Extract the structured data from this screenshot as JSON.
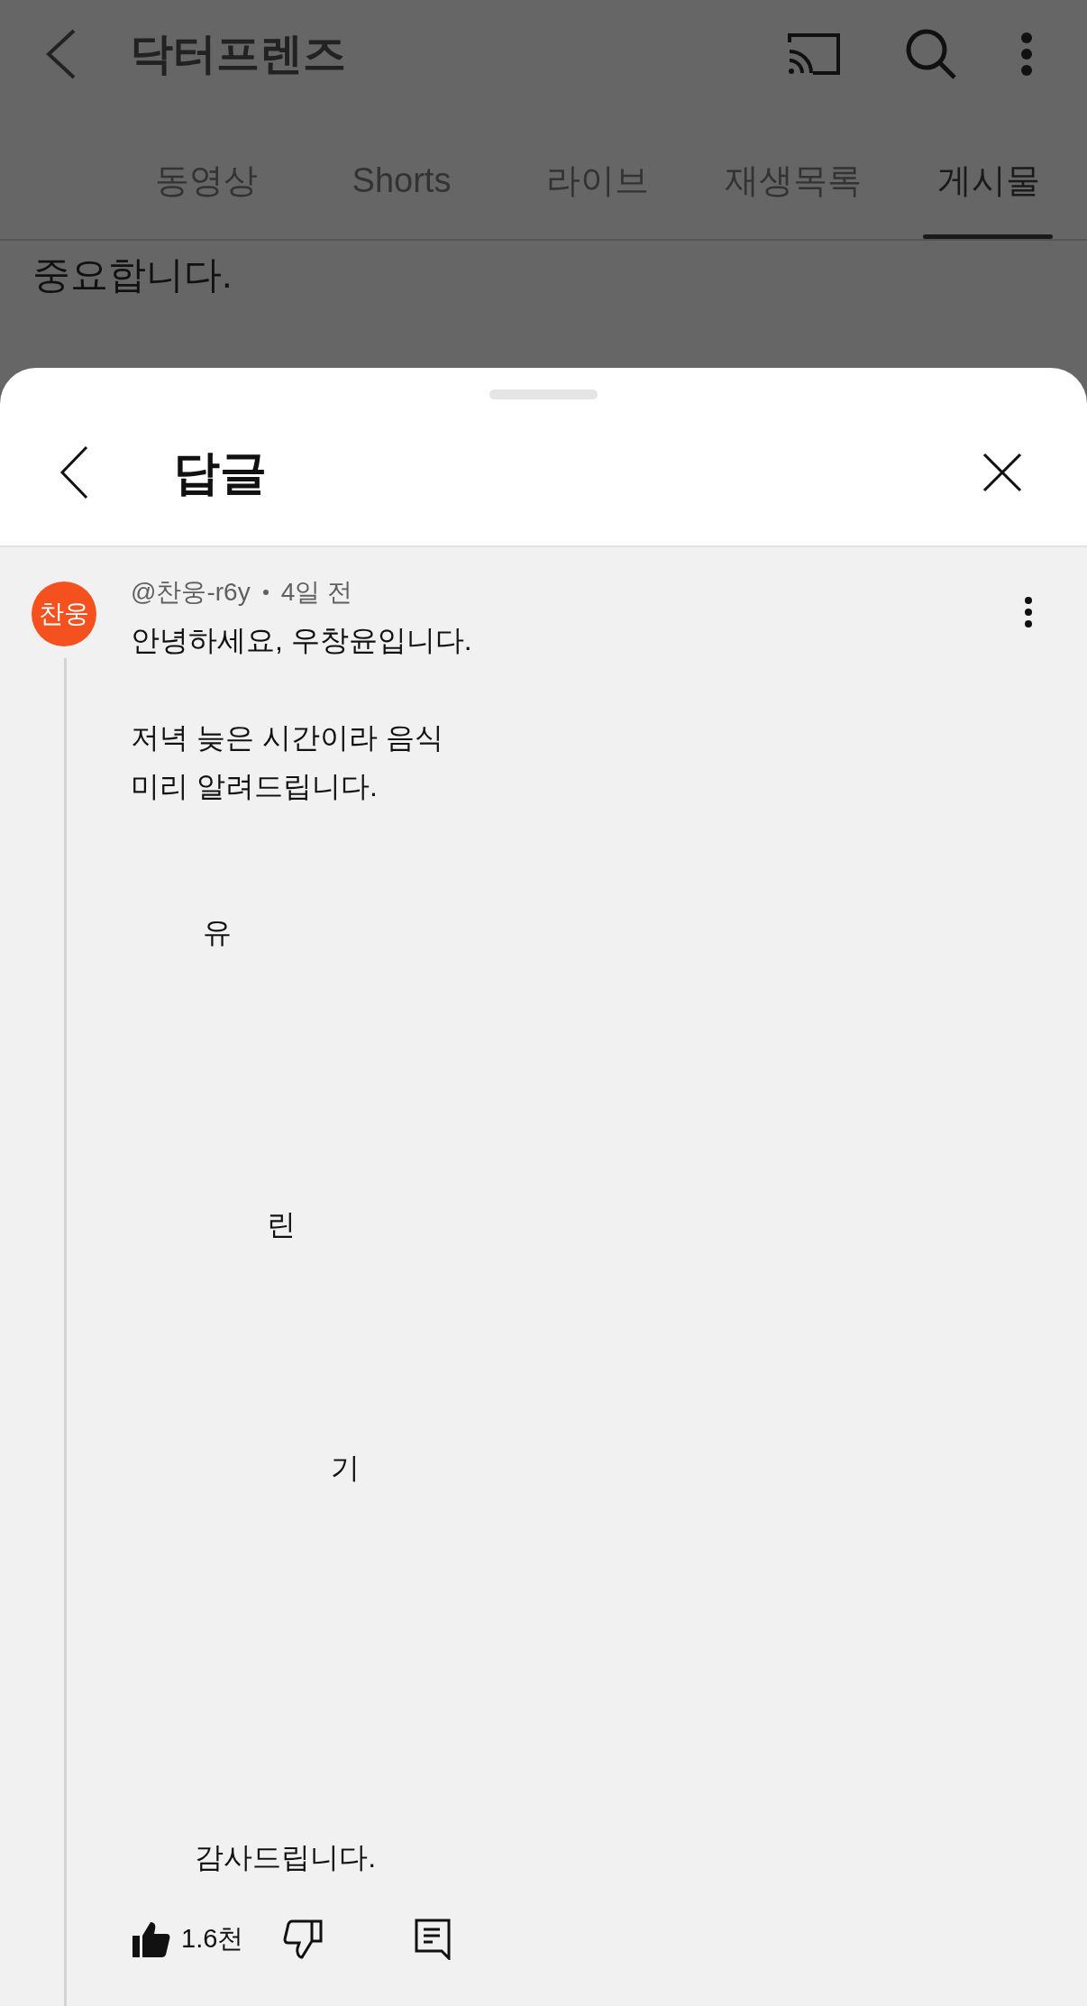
{
  "app_bar": {
    "title": "닥터프렌즈"
  },
  "tabs": [
    {
      "label": "동영상",
      "selected": false
    },
    {
      "label": "Shorts",
      "selected": false
    },
    {
      "label": "라이브",
      "selected": false
    },
    {
      "label": "재생목록",
      "selected": false
    },
    {
      "label": "게시물",
      "selected": true
    }
  ],
  "background_text": "중요합니다.",
  "sheet": {
    "title": "답글"
  },
  "comment": {
    "avatar_text": "찬웅",
    "author": "@찬웅-r6y",
    "time": "4일 전",
    "text": "안녕하세요, 우창윤입니다.\n\n저녁 늦은 시간이라 음식\n미리 알려드립니다.\n\n\n         유\n\n\n\n\n\n                 린\n\n\n\n\n                         기\n\n\n\n\n\n\n\n        감사드립니다.",
    "likes": "1.6천"
  }
}
